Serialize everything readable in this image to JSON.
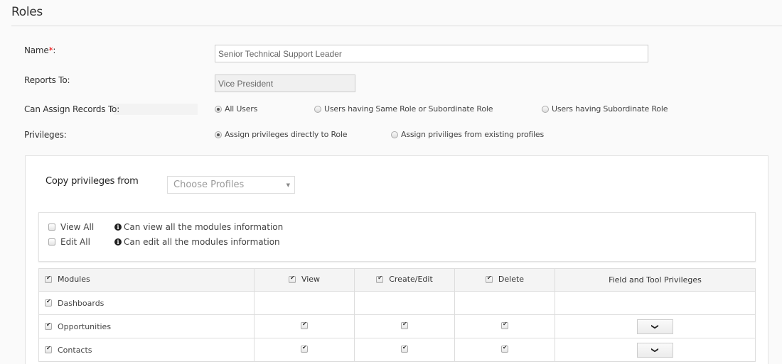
{
  "page": {
    "title": "Roles"
  },
  "form": {
    "name_label": "Name",
    "required_mark": "*",
    "name_colon": ":",
    "name_value": "Senior Technical Support Leader",
    "reports_to_label": "Reports To:",
    "reports_to_value": "Vice President",
    "assign_label": "Can Assign Records To:",
    "assign_options": [
      {
        "label": "All Users",
        "checked": true
      },
      {
        "label": "Users having Same Role or Subordinate Role",
        "checked": false
      },
      {
        "label": "Users having Subordinate Role",
        "checked": false
      }
    ],
    "privileges_label": "Privileges:",
    "privilege_options": [
      {
        "label": "Assign privileges directly to Role",
        "checked": true
      },
      {
        "label": "Assign priviliges from existing profiles",
        "checked": false
      }
    ]
  },
  "copy": {
    "label": "Copy privileges from",
    "select_placeholder": "Choose Profiles",
    "caret": "▼"
  },
  "all_options": [
    {
      "label": "View All",
      "info": "Can view all the modules information",
      "checked": false
    },
    {
      "label": "Edit All",
      "info": "Can edit all the modules information",
      "checked": false
    }
  ],
  "info_glyph": "i",
  "table": {
    "headers": {
      "modules": "Modules",
      "view": "View",
      "create_edit": "Create/Edit",
      "delete": "Delete",
      "field_tool": "Field and Tool Privileges"
    },
    "rows": [
      {
        "module": "Dashboards",
        "checked": true,
        "view": null,
        "create_edit": null,
        "delete": null,
        "has_field_button": false
      },
      {
        "module": "Opportunities",
        "checked": true,
        "view": true,
        "create_edit": true,
        "delete": true,
        "has_field_button": true
      },
      {
        "module": "Contacts",
        "checked": true,
        "view": true,
        "create_edit": true,
        "delete": true,
        "has_field_button": true
      }
    ],
    "expand_glyph": "❯"
  }
}
